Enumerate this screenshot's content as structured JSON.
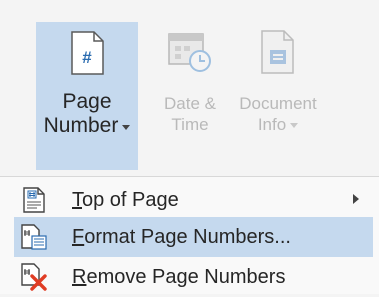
{
  "ribbon": {
    "page_number": {
      "label_line1": "Page",
      "label_line2": "Number",
      "icon_glyph": "#"
    },
    "date_time": {
      "label_line1": "Date &",
      "label_line2": "Time"
    },
    "document_info": {
      "label_line1": "Document",
      "label_line2": "Info"
    }
  },
  "menu": {
    "items": [
      {
        "accel": "T",
        "rest": "op of Page",
        "has_submenu": true
      },
      {
        "accel": "F",
        "rest": "ormat Page Numbers...",
        "has_submenu": false,
        "hovered": true
      },
      {
        "accel": "R",
        "rest": "emove Page Numbers",
        "has_submenu": false
      }
    ]
  },
  "colors": {
    "selection": "#c5d9ee",
    "remove_x": "#e03c24",
    "disabled_text": "#b9b9b9"
  }
}
